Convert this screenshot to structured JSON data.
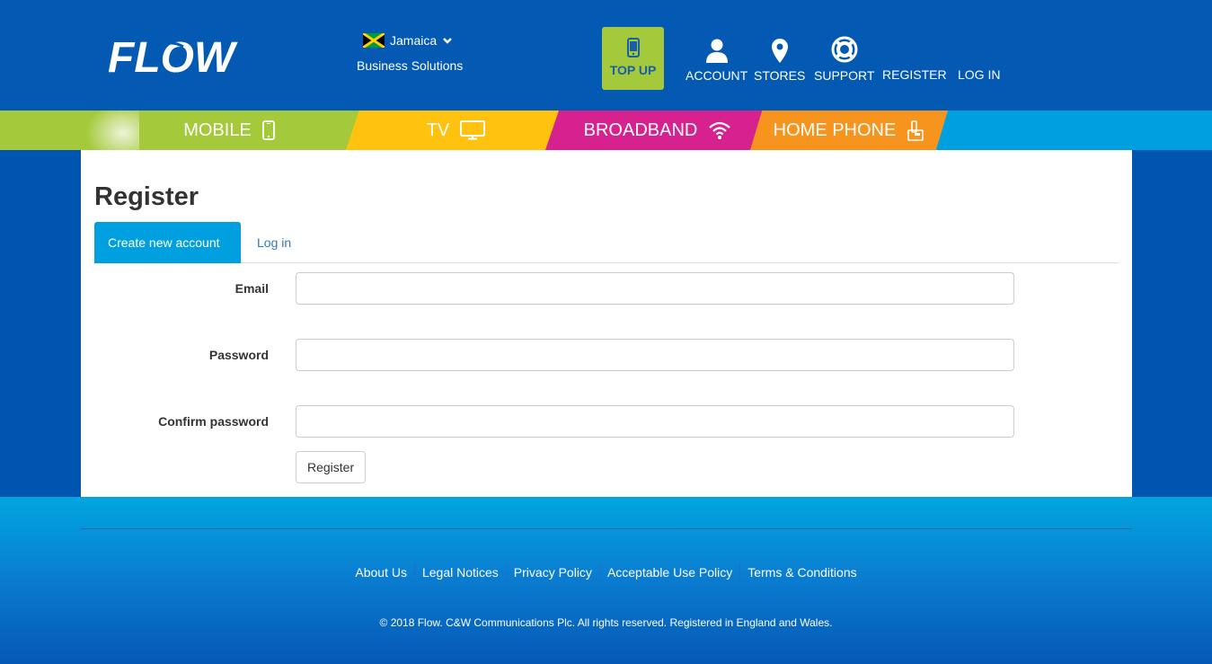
{
  "brand": {
    "logo_text": "FLOW"
  },
  "header": {
    "country": "Jamaica",
    "business": "Business Solutions",
    "topup_label": "TOP UP",
    "nav": {
      "account": "ACCOUNT",
      "stores": "STORES",
      "support": "SUPPORT",
      "register": "REGISTER",
      "login": "LOG IN"
    }
  },
  "categories": {
    "mobile": "MOBILE",
    "tv": "TV",
    "broadband": "BROADBAND",
    "homephone": "HOME PHONE"
  },
  "main": {
    "title": "Register",
    "tabs": {
      "create": "Create new account",
      "login": "Log in"
    },
    "form": {
      "email_label": "Email",
      "email_value": "",
      "password_label": "Password",
      "password_value": "",
      "confirm_label": "Confirm password",
      "confirm_value": "",
      "submit_label": "Register"
    }
  },
  "footer": {
    "links": {
      "about": "About Us",
      "legal": "Legal Notices",
      "privacy": "Privacy Policy",
      "aup": "Acceptable Use Policy",
      "terms": "Terms & Conditions"
    },
    "copyright": "© 2018 Flow. C&W Communications Plc. All rights reserved. Registered in England and Wales."
  },
  "colors": {
    "header_bg": "#0459b3",
    "topup_bg": "#a4c93b",
    "mobile": "#a4c93b",
    "tv": "#ffc20e",
    "broadband": "#d7218e",
    "homephone": "#f7941d",
    "strip_bg": "#00a0e0",
    "tab_active": "#00a0e0"
  }
}
